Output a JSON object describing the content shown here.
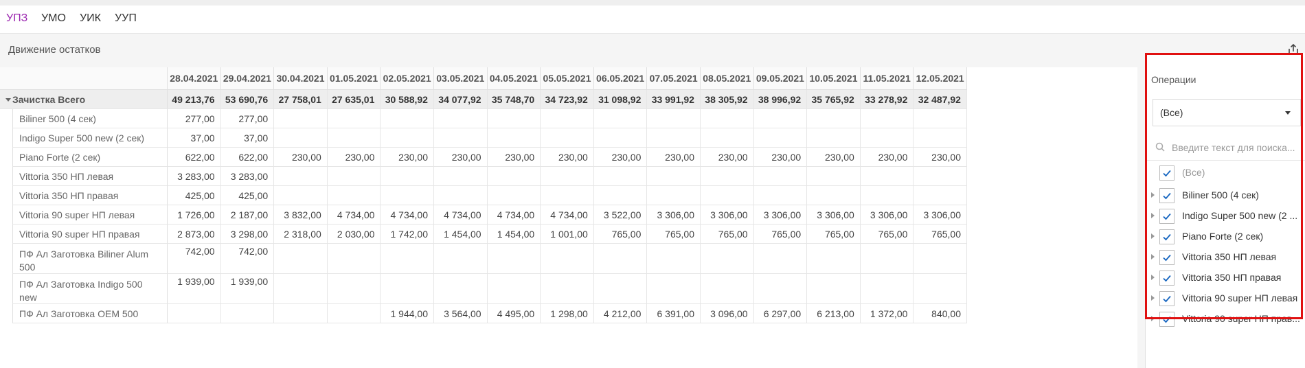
{
  "tabs": [
    {
      "label": "УПЗ",
      "active": true
    },
    {
      "label": "УМО",
      "active": false
    },
    {
      "label": "УИК",
      "active": false
    },
    {
      "label": "УУП",
      "active": false
    }
  ],
  "report": {
    "title": "Движение остатков"
  },
  "dates": [
    "28.04.2021",
    "29.04.2021",
    "30.04.2021",
    "01.05.2021",
    "02.05.2021",
    "03.05.2021",
    "04.05.2021",
    "05.05.2021",
    "06.05.2021",
    "07.05.2021",
    "08.05.2021",
    "09.05.2021",
    "10.05.2021",
    "11.05.2021",
    "12.05.2021"
  ],
  "total": {
    "label": "Зачистка Всего",
    "values": [
      "49 213,76",
      "53 690,76",
      "27 758,01",
      "27 635,01",
      "30 588,92",
      "34 077,92",
      "35 748,70",
      "34 723,92",
      "31 098,92",
      "33 991,92",
      "38 305,92",
      "38 996,92",
      "35 765,92",
      "33 278,92",
      "32 487,92"
    ]
  },
  "rows": [
    {
      "label": "Biliner 500 (4 сек)",
      "values": [
        "277,00",
        "277,00",
        "",
        "",
        "",
        "",
        "",
        "",
        "",
        "",
        "",
        "",
        "",
        "",
        ""
      ]
    },
    {
      "label": "Indigo Super 500 new (2 сек)",
      "values": [
        "37,00",
        "37,00",
        "",
        "",
        "",
        "",
        "",
        "",
        "",
        "",
        "",
        "",
        "",
        "",
        ""
      ]
    },
    {
      "label": "Piano Forte (2 сек)",
      "values": [
        "622,00",
        "622,00",
        "230,00",
        "230,00",
        "230,00",
        "230,00",
        "230,00",
        "230,00",
        "230,00",
        "230,00",
        "230,00",
        "230,00",
        "230,00",
        "230,00",
        "230,00"
      ]
    },
    {
      "label": "Vittoria 350 НП левая",
      "values": [
        "3 283,00",
        "3 283,00",
        "",
        "",
        "",
        "",
        "",
        "",
        "",
        "",
        "",
        "",
        "",
        "",
        ""
      ]
    },
    {
      "label": "Vittoria 350 НП правая",
      "values": [
        "425,00",
        "425,00",
        "",
        "",
        "",
        "",
        "",
        "",
        "",
        "",
        "",
        "",
        "",
        "",
        ""
      ]
    },
    {
      "label": "Vittoria 90 super НП левая",
      "values": [
        "1 726,00",
        "2 187,00",
        "3 832,00",
        "4 734,00",
        "4 734,00",
        "4 734,00",
        "4 734,00",
        "4 734,00",
        "3 522,00",
        "3 306,00",
        "3 306,00",
        "3 306,00",
        "3 306,00",
        "3 306,00",
        "3 306,00"
      ]
    },
    {
      "label": "Vittoria 90 super НП правая",
      "values": [
        "2 873,00",
        "3 298,00",
        "2 318,00",
        "2 030,00",
        "1 742,00",
        "1 454,00",
        "1 454,00",
        "1 001,00",
        "765,00",
        "765,00",
        "765,00",
        "765,00",
        "765,00",
        "765,00",
        "765,00"
      ]
    },
    {
      "label": "ПФ Ал Заготовка Biliner Alum 500",
      "values": [
        "742,00",
        "742,00",
        "",
        "",
        "",
        "",
        "",
        "",
        "",
        "",
        "",
        "",
        "",
        "",
        ""
      ]
    },
    {
      "label": "ПФ Ал Заготовка Indigo 500 new",
      "values": [
        "1 939,00",
        "1 939,00",
        "",
        "",
        "",
        "",
        "",
        "",
        "",
        "",
        "",
        "",
        "",
        "",
        ""
      ]
    },
    {
      "label": "ПФ Ал Заготовка OEM 500",
      "values": [
        "",
        "",
        "",
        "",
        "1 944,00",
        "3 564,00",
        "4 495,00",
        "1 298,00",
        "4 212,00",
        "6 391,00",
        "3 096,00",
        "6 297,00",
        "6 213,00",
        "1 372,00",
        "840,00"
      ]
    }
  ],
  "filter": {
    "label": "Операции",
    "selected": "(Все)",
    "search_placeholder": "Введите текст для поиска...",
    "options": [
      {
        "label": "(Все)",
        "checked": true,
        "expandable": false
      },
      {
        "label": "Biliner 500 (4 сек)",
        "checked": true,
        "expandable": true
      },
      {
        "label": "Indigo Super 500 new (2 ...",
        "checked": true,
        "expandable": true
      },
      {
        "label": "Piano Forte (2 сек)",
        "checked": true,
        "expandable": true
      },
      {
        "label": "Vittoria 350 НП левая",
        "checked": true,
        "expandable": true
      },
      {
        "label": "Vittoria 350 НП правая",
        "checked": true,
        "expandable": true
      },
      {
        "label": "Vittoria 90 super НП левая",
        "checked": true,
        "expandable": true
      },
      {
        "label": "Vittoria 90 super НП прав...",
        "checked": true,
        "expandable": true
      }
    ]
  },
  "colors": {
    "accent": "#9c27b0",
    "highlight": "#e01010",
    "check": "#1565c0"
  }
}
